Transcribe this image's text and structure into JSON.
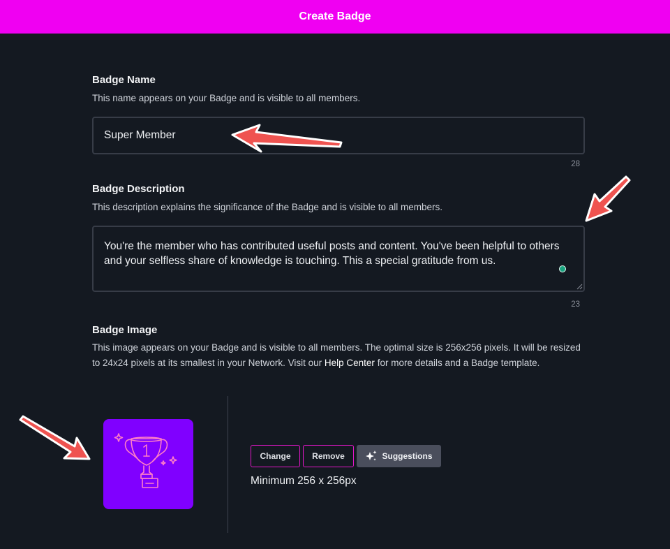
{
  "header": {
    "title": "Create Badge"
  },
  "badge_name": {
    "title": "Badge Name",
    "help": "This name appears on your Badge and is visible to all members.",
    "value": "Super Member",
    "counter": "28"
  },
  "badge_description": {
    "title": "Badge Description",
    "help": "This description explains the significance of the Badge and is visible to all members.",
    "value": "You're the member who has contributed useful posts and content. You've been helpful to others and your selfless share of knowledge is touching. This a special gratitude from us.",
    "counter": "23"
  },
  "badge_image": {
    "title": "Badge Image",
    "help_before_link": "This image appears on your Badge and is visible to all members. The optimal size is 256x256 pixels. It will be resized to 24x24 pixels at its smallest in your Network. Visit our ",
    "help_link": "Help Center",
    "help_after_link": " for more details and a Badge template.",
    "change_label": "Change",
    "remove_label": "Remove",
    "suggestions_label": "Suggestions",
    "min_size": "Minimum 256 x 256px",
    "preview_icon": "trophy-icon"
  },
  "colors": {
    "header": "#f000f2",
    "background": "#141921",
    "badge_background": "#8000ff",
    "button_border": "#e316c8",
    "annotation_arrow": "#ef5350"
  }
}
